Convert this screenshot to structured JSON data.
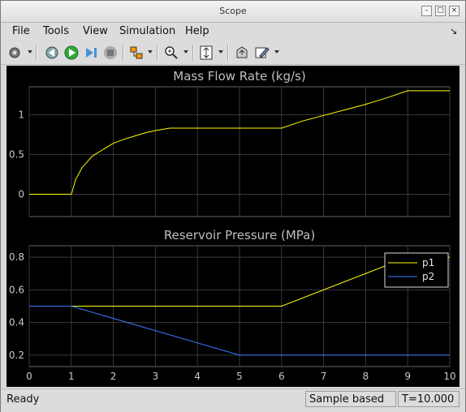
{
  "window": {
    "title": "Scope"
  },
  "menu": [
    "File",
    "Tools",
    "View",
    "Simulation",
    "Help"
  ],
  "status": {
    "left": "Ready",
    "mode": "Sample based",
    "time": "T=10.000"
  },
  "chart_data": [
    {
      "type": "line",
      "title": "Mass Flow Rate (kg/s)",
      "xlim": [
        0,
        10
      ],
      "ylim": [
        -0.28,
        1.35
      ],
      "xticks": [
        0,
        1,
        2,
        3,
        4,
        5,
        6,
        7,
        8,
        9,
        10
      ],
      "yticks": [
        0,
        0.5,
        1
      ],
      "grid": true,
      "series": [
        {
          "color": "#ffff00",
          "x": [
            0,
            1,
            1.02,
            1.1,
            1.25,
            1.5,
            1.75,
            2,
            2.25,
            2.5,
            2.75,
            3,
            3.34,
            4,
            5,
            5.5,
            6,
            6.5,
            7,
            7.5,
            8,
            8.5,
            9,
            9.5,
            10
          ],
          "y": [
            0,
            0,
            0.03,
            0.18,
            0.33,
            0.48,
            0.56,
            0.64,
            0.69,
            0.73,
            0.77,
            0.8,
            0.83,
            0.83,
            0.83,
            0.83,
            0.83,
            0.92,
            0.99,
            1.06,
            1.13,
            1.21,
            1.3,
            1.3,
            1.3
          ]
        }
      ]
    },
    {
      "type": "line",
      "title": "Reservoir Pressure (MPa)",
      "xlim": [
        0,
        10
      ],
      "ylim": [
        0.13,
        0.87
      ],
      "xticks": [
        0,
        1,
        2,
        3,
        4,
        5,
        6,
        7,
        8,
        9,
        10
      ],
      "yticks": [
        0.2,
        0.4,
        0.6,
        0.8
      ],
      "grid": true,
      "legend": "top-right",
      "series": [
        {
          "name": "p1",
          "color": "#ffff00",
          "x": [
            0,
            1,
            6,
            9,
            10
          ],
          "y": [
            0.5,
            0.5,
            0.5,
            0.8,
            0.8
          ]
        },
        {
          "name": "p2",
          "color": "#3a7bff",
          "x": [
            0,
            1,
            5,
            10
          ],
          "y": [
            0.5,
            0.5,
            0.2,
            0.2
          ]
        }
      ]
    }
  ]
}
